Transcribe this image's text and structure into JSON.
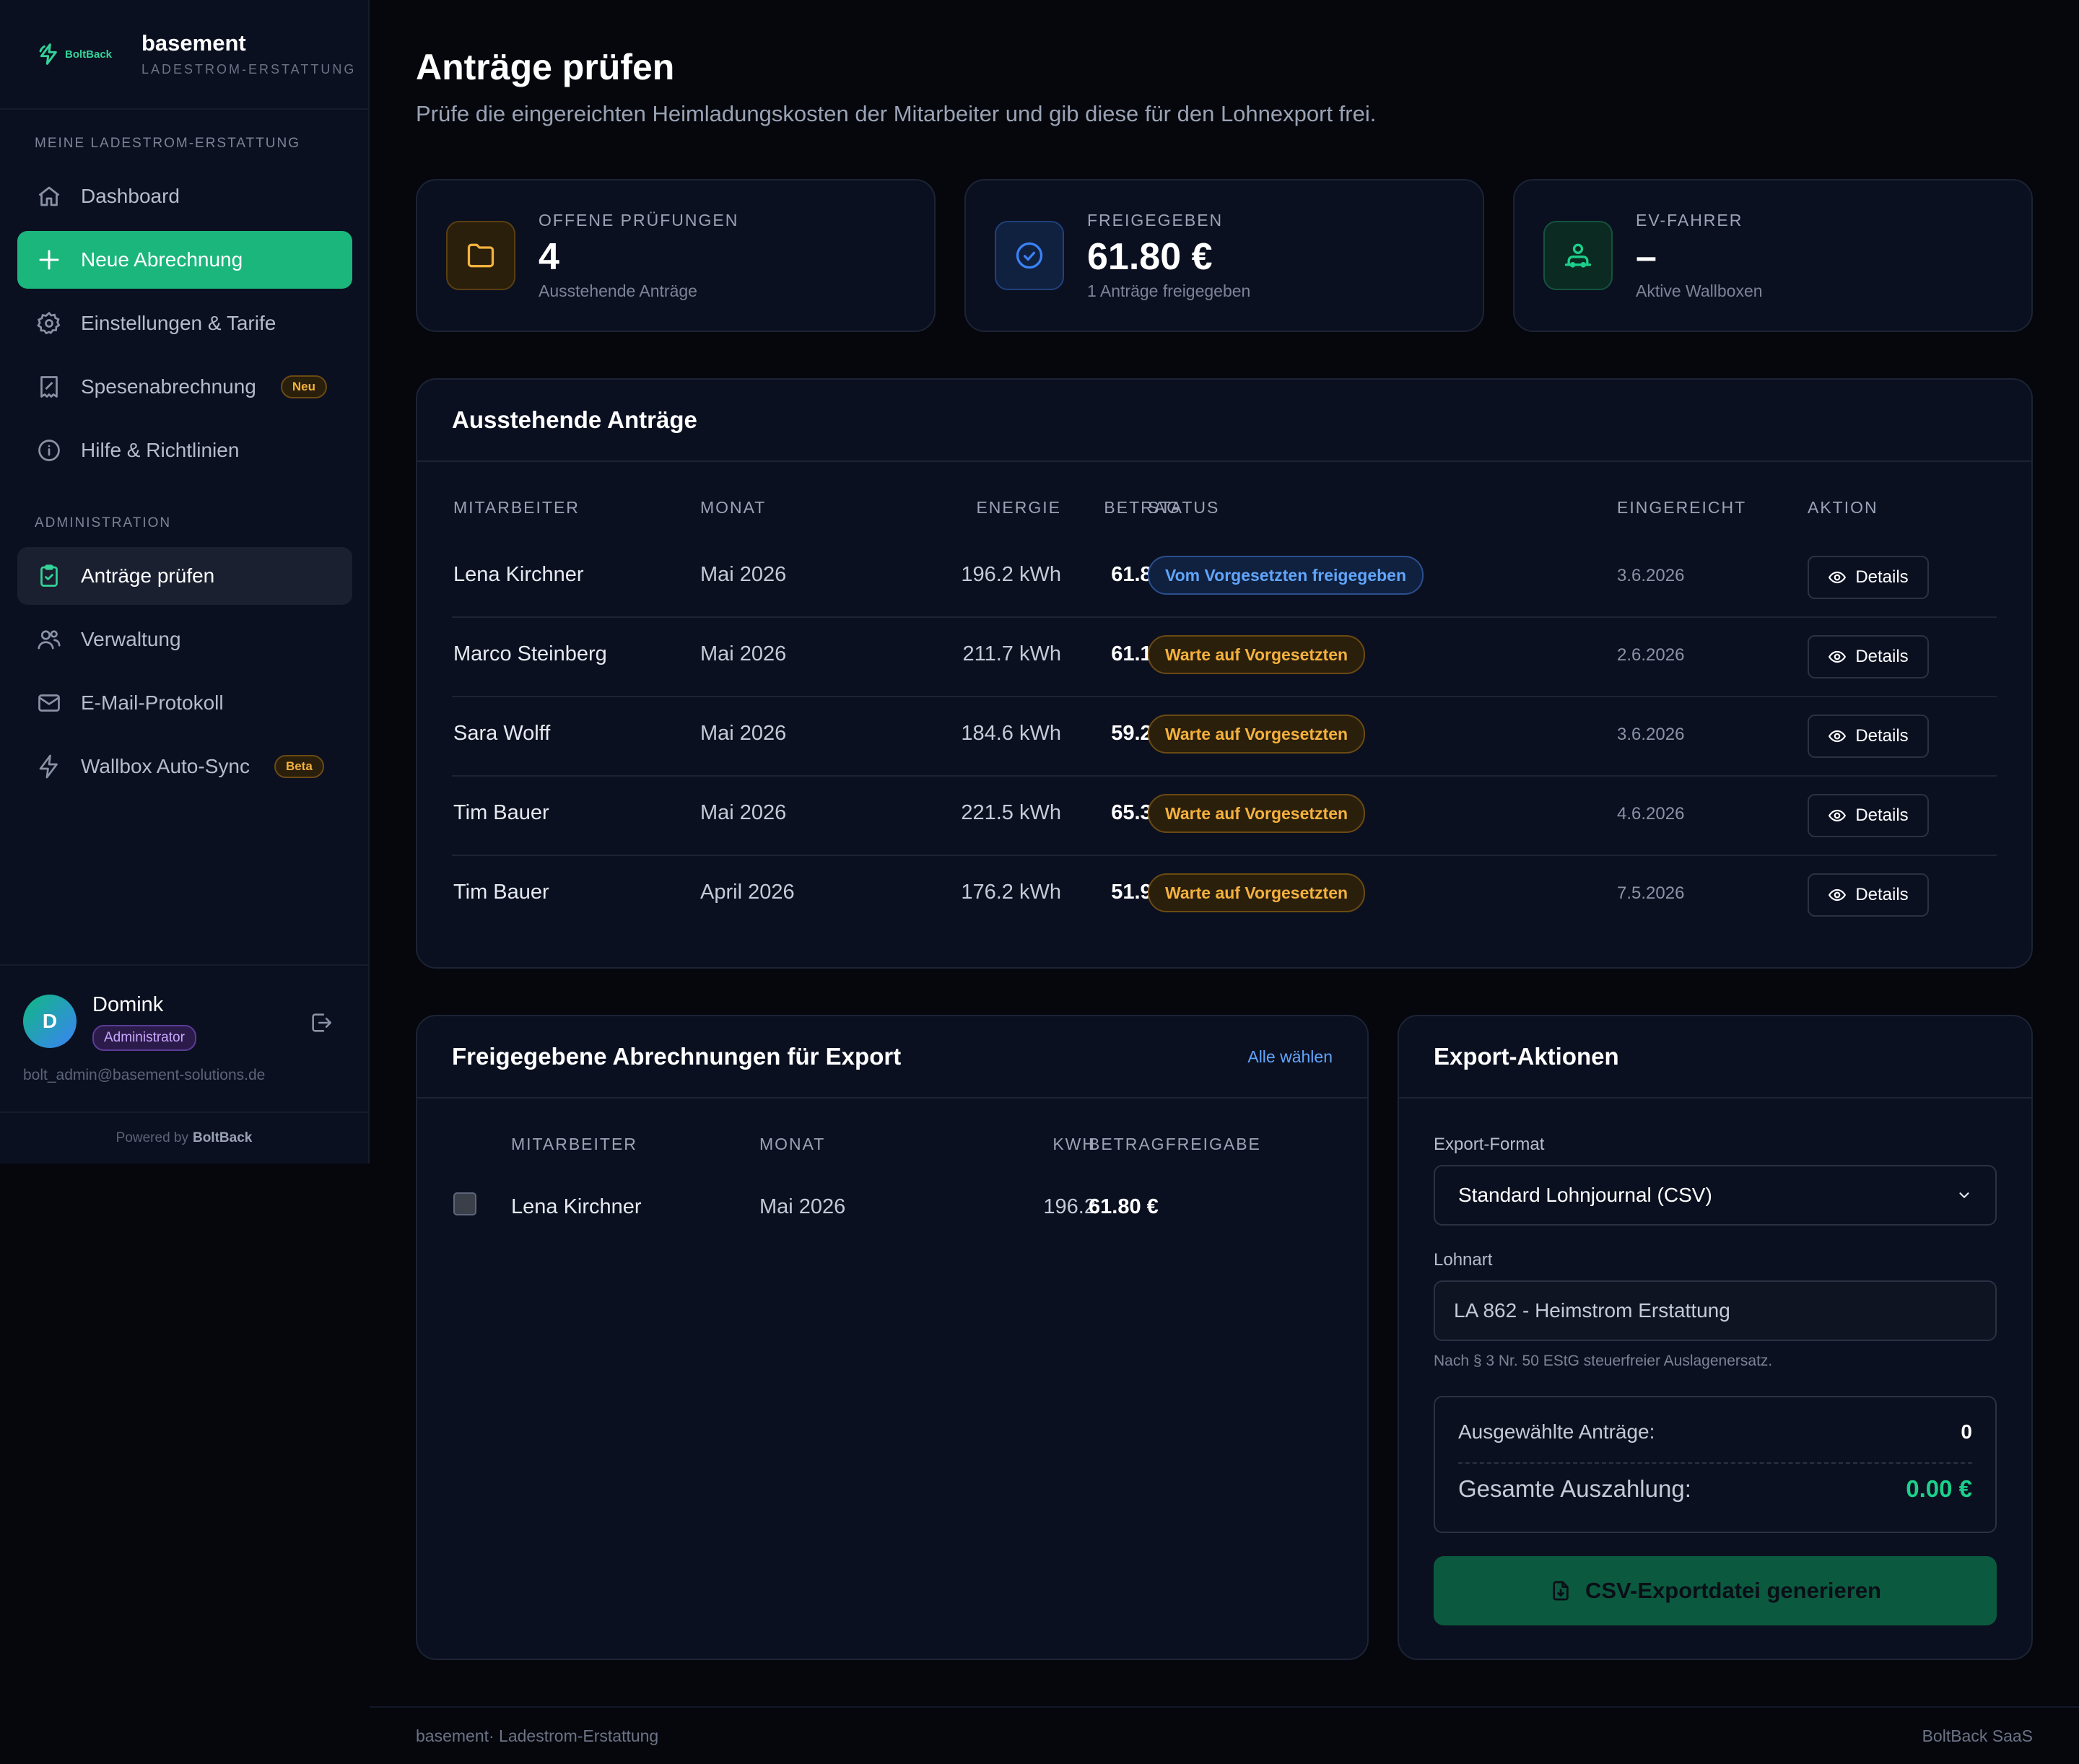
{
  "brand": {
    "logo_text": "BoltBack",
    "name": "basement",
    "subtitle": "LADESTROM-ERSTATTUNG"
  },
  "sidebar": {
    "section1_title": "MEINE LADESTROM-ERSTATTUNG",
    "items": [
      {
        "label": "Dashboard",
        "icon": "home-icon"
      },
      {
        "label": "Neue Abrechnung",
        "icon": "plus-icon"
      },
      {
        "label": "Einstellungen & Tarife",
        "icon": "gear-icon"
      },
      {
        "label": "Spesenabrechnung",
        "icon": "receipt-icon",
        "badge": "Neu"
      },
      {
        "label": "Hilfe & Richtlinien",
        "icon": "info-icon"
      }
    ],
    "section2_title": "ADMINISTRATION",
    "admin_items": [
      {
        "label": "Anträge prüfen",
        "icon": "clipboard-check-icon"
      },
      {
        "label": "Verwaltung",
        "icon": "users-icon"
      },
      {
        "label": "E-Mail-Protokoll",
        "icon": "mail-icon"
      },
      {
        "label": "Wallbox Auto-Sync",
        "icon": "bolt-icon",
        "badge": "Beta"
      }
    ]
  },
  "user": {
    "initial": "D",
    "name": "Domink",
    "role": "Administrator",
    "email": "bolt_admin@basement-solutions.de"
  },
  "powered": {
    "prefix": "Powered by",
    "brand": "BoltBack"
  },
  "page": {
    "title": "Anträge prüfen",
    "subtitle": "Prüfe die eingereichten Heimladungskosten der Mitarbeiter und gib diese für den Lohnexport frei."
  },
  "stats": [
    {
      "label": "OFFENE PRÜFUNGEN",
      "value": "4",
      "sub": "Ausstehende Anträge",
      "icon": "folder-icon",
      "accent": "#f5b13d"
    },
    {
      "label": "FREIGEGEBEN",
      "value": "61.80 €",
      "sub": "1 Anträge freigegeben",
      "icon": "check-circle-icon",
      "accent": "#3b82f6"
    },
    {
      "label": "EV-FAHRER",
      "value": "–",
      "sub": "Aktive Wallboxen",
      "icon": "driver-icon",
      "accent": "#1bd08a"
    }
  ],
  "pending": {
    "title": "Ausstehende Anträge",
    "columns": [
      "MITARBEITER",
      "MONAT",
      "ENERGIE",
      "BETRAG",
      "STATUS",
      "EINGEREICHT",
      "AKTION"
    ],
    "rows": [
      {
        "employee": "Lena Kirchner",
        "month": "Mai 2026",
        "energy": "196.2 kWh",
        "amount": "61.80 €",
        "status": "Vom Vorgesetzten freigegeben",
        "status_type": "approved",
        "submitted": "3.6.2026",
        "action": "Details"
      },
      {
        "employee": "Marco Steinberg",
        "month": "Mai 2026",
        "energy": "211.7 kWh",
        "amount": "61.18 €",
        "status": "Warte auf Vorgesetzten",
        "status_type": "waiting",
        "submitted": "2.6.2026",
        "action": "Details"
      },
      {
        "employee": "Sara Wolff",
        "month": "Mai 2026",
        "energy": "184.6 kWh",
        "amount": "59.26 €",
        "status": "Warte auf Vorgesetzten",
        "status_type": "waiting",
        "submitted": "3.6.2026",
        "action": "Details"
      },
      {
        "employee": "Tim Bauer",
        "month": "Mai 2026",
        "energy": "221.5 kWh",
        "amount": "65.34 €",
        "status": "Warte auf Vorgesetzten",
        "status_type": "waiting",
        "submitted": "4.6.2026",
        "action": "Details"
      },
      {
        "employee": "Tim Bauer",
        "month": "April 2026",
        "energy": "176.2 kWh",
        "amount": "51.98 €",
        "status": "Warte auf Vorgesetzten",
        "status_type": "waiting",
        "submitted": "7.5.2026",
        "action": "Details"
      }
    ]
  },
  "approved": {
    "title": "Freigegebene Abrechnungen für Export",
    "select_all": "Alle wählen",
    "columns": [
      "MITARBEITER",
      "MONAT",
      "KWH",
      "BETRAGFREIGABE"
    ],
    "rows": [
      {
        "employee": "Lena Kirchner",
        "month": "Mai 2026",
        "kwh": "196.2",
        "amount": "61.80 €",
        "checked": false
      }
    ]
  },
  "export": {
    "title": "Export-Aktionen",
    "format_label": "Export-Format",
    "format_value": "Standard Lohnjournal (CSV)",
    "wage_label": "Lohnart",
    "wage_value": "LA 862 - Heimstrom Erstattung",
    "hint": "Nach § 3 Nr. 50 EStG steuerfreier Auslagenersatz.",
    "selected_label": "Ausgewählte Anträge:",
    "selected_value": "0",
    "total_label": "Gesamte Auszahlung:",
    "total_value": "0.00 €",
    "button": "CSV-Exportdatei generieren"
  },
  "footer": {
    "left": "basement· Ladestrom-Erstattung",
    "right": "BoltBack SaaS"
  }
}
